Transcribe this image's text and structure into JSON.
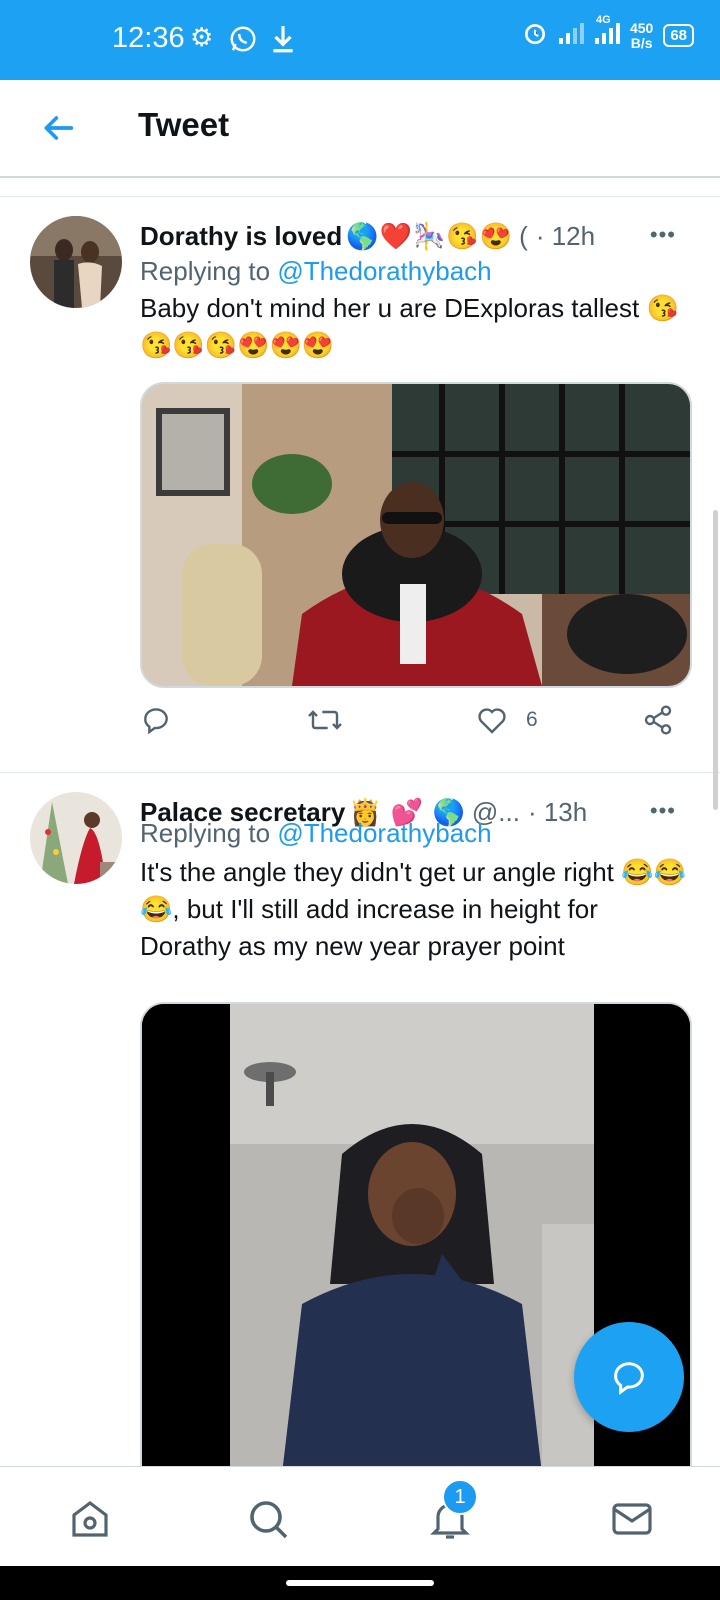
{
  "status_bar": {
    "time": "12:36",
    "network": "4G",
    "speed_value": "450",
    "speed_unit": "B/s",
    "battery": "68"
  },
  "header": {
    "title": "Tweet"
  },
  "tweets": [
    {
      "name": "Dorathy is loved",
      "name_emojis": "🌎❤️🎠😘😍",
      "handle": "(",
      "time": "· 12h",
      "replying_prefix": "Replying to ",
      "replying_to": "@Thedorathybach",
      "text": "Baby don't mind her u are DExploras tallest 😘😘😘😘😍😍😍",
      "actions": {
        "likes": "6"
      }
    },
    {
      "name": "Palace secretary",
      "name_emojis": "👸 💕 🌎",
      "handle": "@...",
      "time": "· 13h",
      "replying_prefix": "Replying to ",
      "replying_to": "@Thedorathybach",
      "text": "It's the angle they didn't get ur angle right 😂😂😂, but I'll still add increase in height for Dorathy as my new year prayer point"
    }
  ],
  "more_icon": "•••",
  "notifications_badge": "1",
  "colors": {
    "accent": "#1da1f2",
    "link": "#1d9bf0",
    "secondary_text": "#536471"
  }
}
